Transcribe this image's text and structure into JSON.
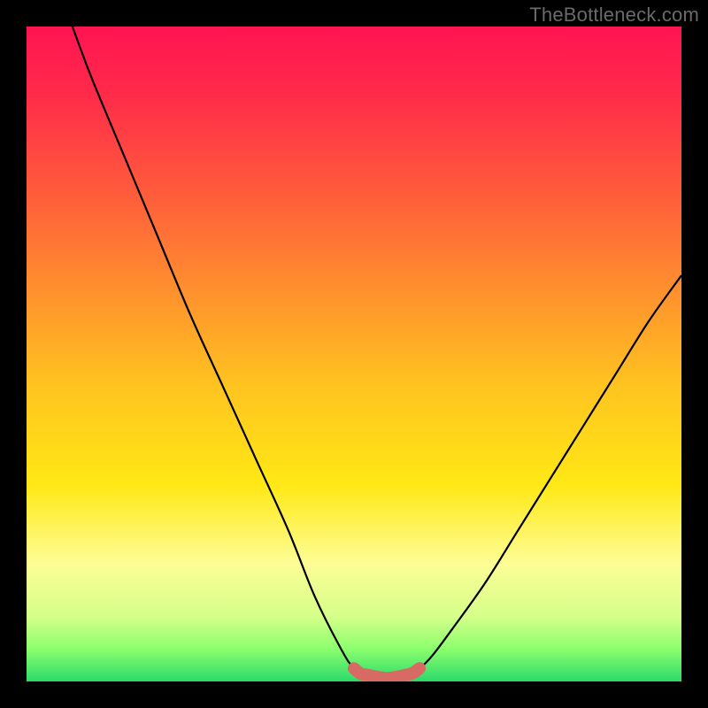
{
  "watermark": "TheBottleneck.com",
  "chart_data": {
    "type": "line",
    "title": "",
    "xlabel": "",
    "ylabel": "",
    "xlim": [
      0,
      100
    ],
    "ylim": [
      0,
      100
    ],
    "series": [
      {
        "name": "bottleneck-curve",
        "x": [
          7,
          10,
          15,
          20,
          25,
          30,
          35,
          40,
          44,
          48,
          50,
          52,
          55,
          58,
          60,
          62,
          65,
          70,
          75,
          80,
          85,
          90,
          95,
          100
        ],
        "y": [
          100,
          92,
          80,
          68,
          56,
          45,
          34,
          23,
          13,
          5,
          2,
          1,
          0.5,
          1,
          2,
          4,
          8,
          15,
          23,
          31,
          39,
          47,
          55,
          62
        ]
      },
      {
        "name": "optimal-zone",
        "x": [
          50,
          51,
          52,
          53,
          54,
          55,
          56,
          57,
          58,
          59,
          60
        ],
        "y": [
          2,
          1.2,
          1,
          0.8,
          0.6,
          0.5,
          0.6,
          0.8,
          1,
          1.3,
          2
        ]
      }
    ],
    "gradient_bands": {
      "description": "vertical gradient from red (top) through orange, yellow, light-yellow to green (bottom)",
      "stops": [
        {
          "offset": 0.0,
          "color": "#ff1452"
        },
        {
          "offset": 0.1,
          "color": "#ff2a4a"
        },
        {
          "offset": 0.25,
          "color": "#ff5a3c"
        },
        {
          "offset": 0.4,
          "color": "#ff8f2e"
        },
        {
          "offset": 0.55,
          "color": "#ffc420"
        },
        {
          "offset": 0.7,
          "color": "#ffe815"
        },
        {
          "offset": 0.82,
          "color": "#fdfd96"
        },
        {
          "offset": 0.9,
          "color": "#d6ff8a"
        },
        {
          "offset": 0.95,
          "color": "#8cff6e"
        },
        {
          "offset": 1.0,
          "color": "#2bd96b"
        }
      ]
    },
    "marker_color": "#d76a63",
    "curve_color": "#000000"
  }
}
